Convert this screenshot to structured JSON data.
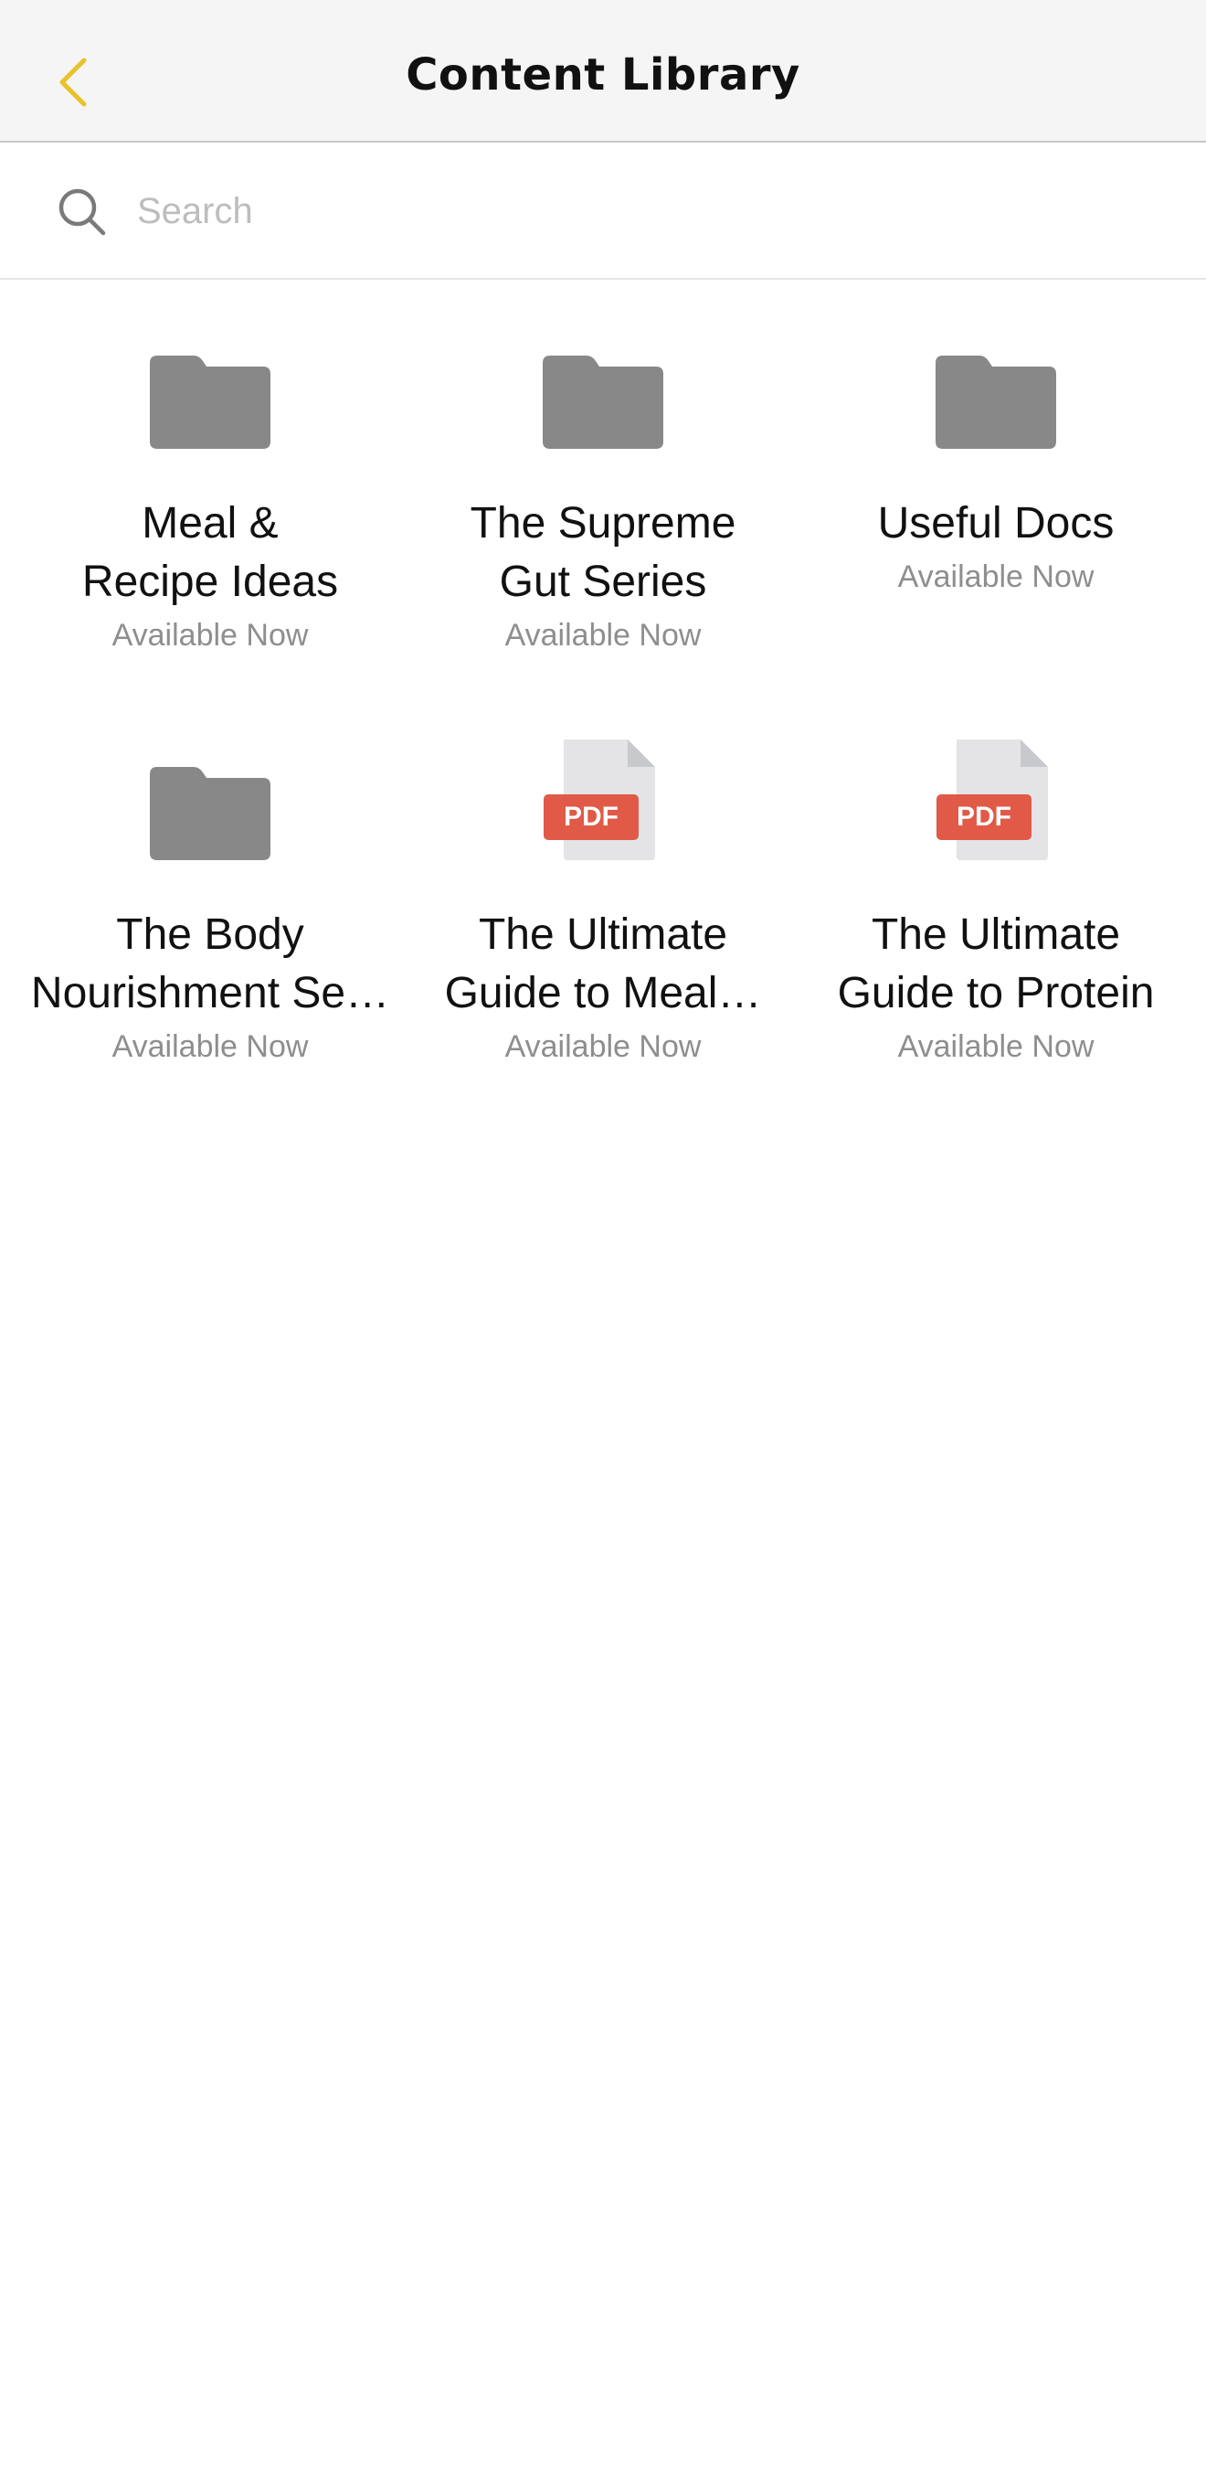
{
  "header": {
    "title": "Content Library",
    "back_icon": "chevron-left-icon",
    "accent_color": "#e8c22a",
    "background_color": "#f5f5f5"
  },
  "search": {
    "placeholder": "Search",
    "value": "",
    "icon": "search-icon"
  },
  "items": [
    {
      "type": "folder",
      "icon": "folder-icon",
      "title": "Meal &\nRecipe Ideas",
      "status": "Available Now"
    },
    {
      "type": "folder",
      "icon": "folder-icon",
      "title": "The Supreme\nGut Series",
      "status": "Available Now"
    },
    {
      "type": "folder",
      "icon": "folder-icon",
      "title": "Useful Docs",
      "status": "Available Now"
    },
    {
      "type": "folder",
      "icon": "folder-icon",
      "title": "The Body\nNourishment Se…",
      "status": "Available Now"
    },
    {
      "type": "pdf",
      "icon": "pdf-file-icon",
      "badge": "PDF",
      "title": "The Ultimate\nGuide to Meal…",
      "status": "Available Now"
    },
    {
      "type": "pdf",
      "icon": "pdf-file-icon",
      "badge": "PDF",
      "title": "The Ultimate\nGuide to Protein",
      "status": "Available Now"
    }
  ],
  "colors": {
    "folder": "#888888",
    "pdf_page": "#e4e4e6",
    "pdf_fold": "#c8c9cc",
    "pdf_badge": "#e05a47",
    "status_text": "#8e8e8e"
  }
}
